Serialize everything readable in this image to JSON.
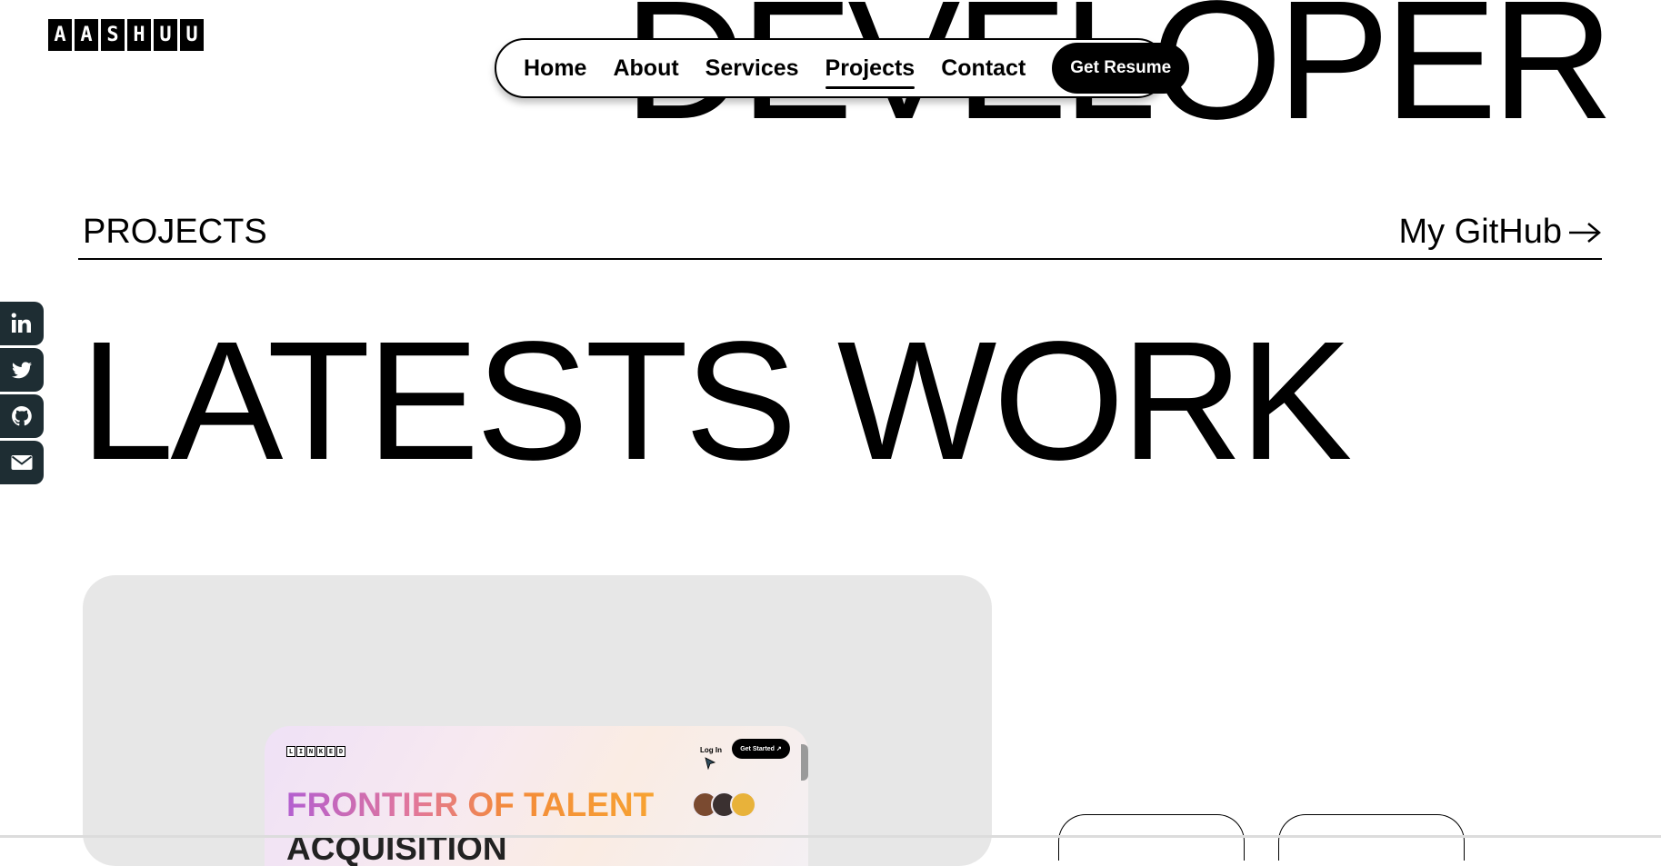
{
  "hero": {
    "big_word": "DEVELOPER"
  },
  "logo": {
    "letters": [
      "A",
      "A",
      "S",
      "H",
      "U",
      "U"
    ]
  },
  "nav": {
    "links": [
      "Home",
      "About",
      "Services",
      "Projects",
      "Contact"
    ],
    "active": "Projects",
    "cta": "Get Resume"
  },
  "section": {
    "label": "PROJECTS",
    "github_link": "My GitHub",
    "arrow_icon": "arrow-right-icon",
    "headline": "LATESTS WORK"
  },
  "social": {
    "icons": [
      "linkedin-icon",
      "twitter-icon",
      "github-icon",
      "mail-icon"
    ],
    "bg_color": "#1e2d33"
  },
  "project_card": {
    "bg_color": "#e7e7e7",
    "preview": {
      "logo_letters": [
        "L",
        "I",
        "N",
        "K",
        "E",
        "D"
      ],
      "login": "Log In",
      "get_started": "Get Started ↗",
      "title_line1": "FRONTIER OF TALENT",
      "title_line2": "ACQUISITION",
      "gradient_colors": [
        "#b35fd0",
        "#e2779a",
        "#f38a3a",
        "#f7a332"
      ]
    }
  }
}
